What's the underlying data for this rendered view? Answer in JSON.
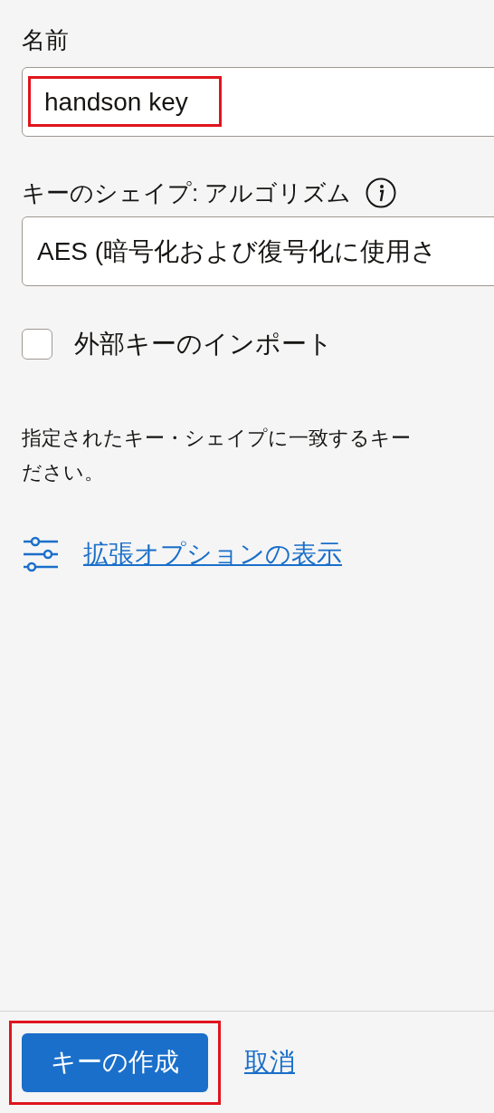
{
  "name_field": {
    "label": "名前",
    "value": "handson key",
    "highlighted": true
  },
  "key_shape": {
    "label": "キーのシェイプ: アルゴリズム",
    "value": "AES (暗号化および復号化に使用さ"
  },
  "import_external": {
    "label": "外部キーのインポート",
    "checked": false
  },
  "help_text": [
    "指定されたキー・シェイプに一致するキー",
    "ださい。"
  ],
  "advanced_link": "拡張オプションの表示",
  "buttons": {
    "create": {
      "label": "キーの作成",
      "highlighted": true
    },
    "cancel": "取消"
  }
}
